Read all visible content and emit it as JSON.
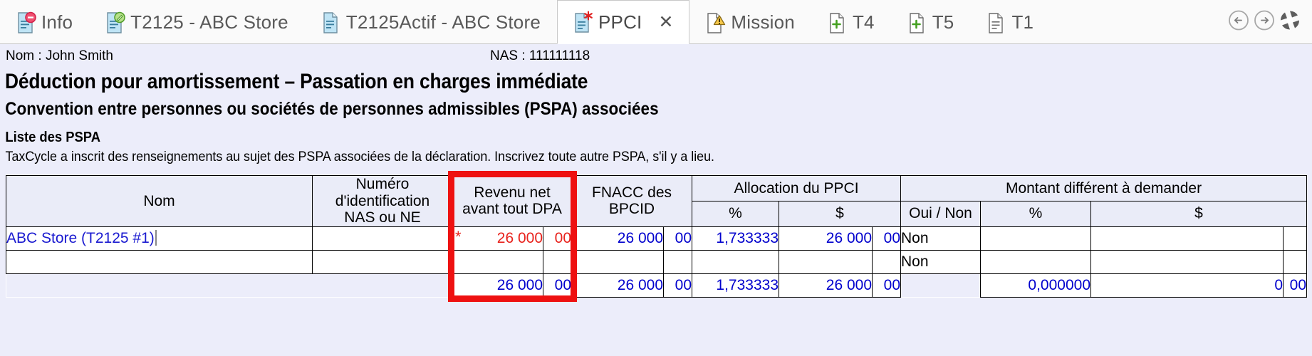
{
  "tabs": [
    {
      "label": "Info",
      "icon": "document-minus-icon",
      "active": false
    },
    {
      "label": "T2125 - ABC Store",
      "icon": "document-edit-icon",
      "active": false
    },
    {
      "label": "T2125Actif - ABC Store",
      "icon": "document-icon",
      "active": false
    },
    {
      "label": "PPCI",
      "icon": "document-asterisk-icon",
      "active": true,
      "close_label": "✕"
    },
    {
      "label": "Mission",
      "icon": "document-warning-icon",
      "active": false
    },
    {
      "label": "T4",
      "icon": "document-plus-icon",
      "active": false
    },
    {
      "label": "T5",
      "icon": "document-plus-icon",
      "active": false
    },
    {
      "label": "T1",
      "icon": "document-lines-icon",
      "active": false
    }
  ],
  "nav": {
    "back_icon": "arrow-left-circle-icon",
    "forward_icon": "arrow-right-circle-icon",
    "refresh_icon": "refresh-icon"
  },
  "header": {
    "nom": "Nom : John Smith",
    "nas": "NAS : 111111118",
    "title": "Déduction pour amortissement – Passation en charges immédiate",
    "subtitle": "Convention entre personnes ou sociétés de personnes admissibles (PSPA) associées",
    "section_heading": "Liste des PSPA",
    "instructions": "TaxCycle a inscrit des renseignements au sujet des PSPA associées de la déclaration. Inscrivez toute autre PSPA, s'il y a lieu."
  },
  "table": {
    "group_headers": {
      "allocation": "Allocation du PPCI",
      "montant": "Montant différent à demander"
    },
    "headers": {
      "nom": "Nom",
      "numero": "Numéro\nd'identification\nNAS ou NE",
      "numero_l1": "Numéro",
      "numero_l2": "d'identification",
      "numero_l3": "NAS ou NE",
      "revenu_l1": "Revenu net",
      "revenu_l2": "avant tout DPA",
      "fnacc_l1": "FNACC des",
      "fnacc_l2": "BPCID",
      "alloc_pct": "%",
      "alloc_dollar": "$",
      "oui_non": "Oui / Non",
      "mont_pct": "%",
      "mont_dollar": "$"
    },
    "rows": [
      {
        "nom": "ABC Store (T2125 #1)",
        "numero": "",
        "revenu_star": "*",
        "revenu": "26 000",
        "revenu_cents": "00",
        "fnacc": "26 000",
        "fnacc_cents": "00",
        "alloc_pct": "1,733333",
        "alloc_dollar": "26 000",
        "alloc_cents": "00",
        "oui_non": "Non",
        "mont_pct": "",
        "mont_dollar": "",
        "mont_cents": ""
      },
      {
        "nom": "",
        "numero": "",
        "revenu_star": "",
        "revenu": "",
        "revenu_cents": "",
        "fnacc": "",
        "fnacc_cents": "",
        "alloc_pct": "",
        "alloc_dollar": "",
        "alloc_cents": "",
        "oui_non": "Non",
        "mont_pct": "",
        "mont_dollar": "",
        "mont_cents": ""
      }
    ],
    "total_row": {
      "revenu": "26 000",
      "revenu_cents": "00",
      "fnacc": "26 000",
      "fnacc_cents": "00",
      "alloc_pct": "1,733333",
      "alloc_dollar": "26 000",
      "alloc_cents": "00",
      "oui_non": "",
      "mont_pct": "0,000000",
      "mont_dollar": "0",
      "mont_cents": "00"
    }
  },
  "annotation": {
    "highlight_color": "#ee1111",
    "highlight_target": "revenu-net-avant-tout-dpa-column"
  }
}
